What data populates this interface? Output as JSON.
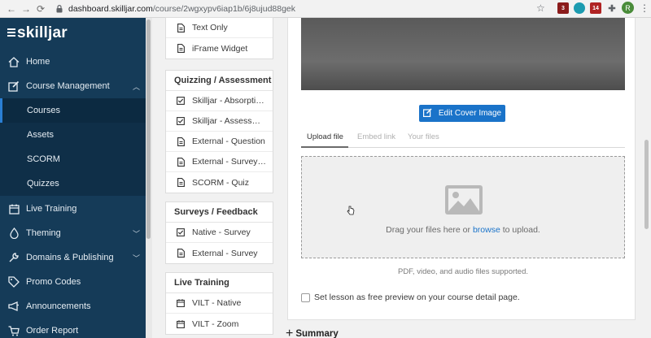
{
  "browser": {
    "url_host": "dashboard.skilljar.com",
    "url_path": "/course/2wgxypv6iap1b/6j8ujud88gek",
    "ext_badges": [
      "3",
      "",
      "14",
      ""
    ],
    "avatar_initial": "R"
  },
  "sidebar": {
    "logo": "skilljar",
    "items": [
      {
        "label": "Home",
        "icon": "home-icon"
      },
      {
        "label": "Course Management",
        "icon": "edit-icon",
        "expanded": true
      },
      {
        "label": "Live Training",
        "icon": "calendar-icon"
      },
      {
        "label": "Theming",
        "icon": "drop-icon"
      },
      {
        "label": "Domains & Publishing",
        "icon": "wrench-icon"
      },
      {
        "label": "Promo Codes",
        "icon": "tag-icon"
      },
      {
        "label": "Announcements",
        "icon": "megaphone-icon"
      },
      {
        "label": "Order Report",
        "icon": "cart-icon"
      }
    ],
    "sub_items": [
      "Courses",
      "Assets",
      "SCORM",
      "Quizzes"
    ],
    "active_sub": "Courses"
  },
  "lesson_types": {
    "top_rows": [
      "Text Only",
      "iFrame Widget"
    ],
    "quizzing": {
      "title": "Quizzing / Assessment",
      "rows": [
        "Skilljar - Absorption Check",
        "Skilljar - Assessment",
        "External - Question",
        "External - Survey Quiz",
        "SCORM - Quiz"
      ]
    },
    "surveys": {
      "title": "Surveys / Feedback",
      "rows": [
        "Native - Survey",
        "External - Survey"
      ]
    },
    "live": {
      "title": "Live Training",
      "rows": [
        "VILT - Native",
        "VILT - Zoom"
      ]
    }
  },
  "editor": {
    "edit_cover_label": "Edit Cover Image",
    "tabs": [
      "Upload file",
      "Embed link",
      "Your files"
    ],
    "active_tab": "Upload file",
    "drop_text_before": "Drag your files here or ",
    "drop_link": "browse",
    "drop_text_after": " to upload.",
    "supported": "PDF, video, and audio files supported.",
    "free_preview_label": "Set lesson as free preview on your course detail page.",
    "free_preview_checked": false,
    "summary_label": "Summary"
  },
  "colors": {
    "sidebar_bg": "#153b58",
    "accent": "#1a73c9"
  }
}
